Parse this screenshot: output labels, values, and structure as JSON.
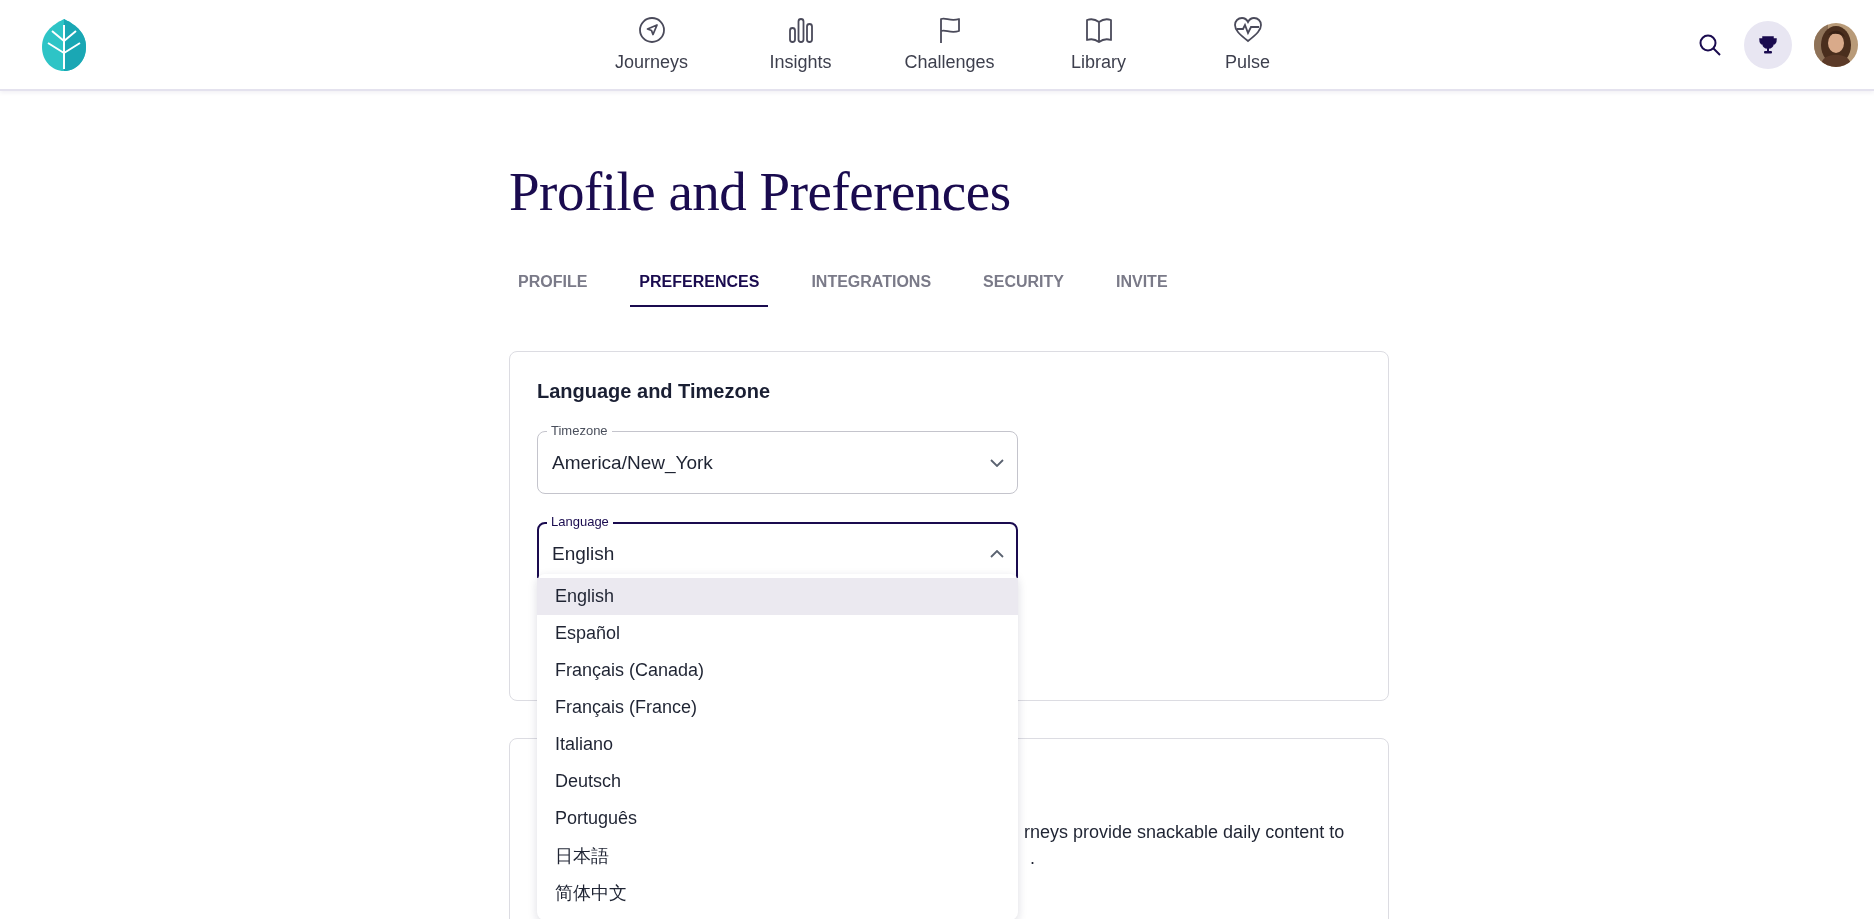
{
  "nav": [
    {
      "label": "Journeys"
    },
    {
      "label": "Insights"
    },
    {
      "label": "Challenges"
    },
    {
      "label": "Library"
    },
    {
      "label": "Pulse"
    }
  ],
  "page_title": "Profile and Preferences",
  "tabs": [
    {
      "label": "PROFILE",
      "selected": false
    },
    {
      "label": "PREFERENCES",
      "selected": true
    },
    {
      "label": "INTEGRATIONS",
      "selected": false
    },
    {
      "label": "SECURITY",
      "selected": false
    },
    {
      "label": "INVITE",
      "selected": false
    }
  ],
  "language_card": {
    "title": "Language and Timezone",
    "timezone": {
      "label": "Timezone",
      "value": "America/New_York",
      "expanded": false
    },
    "language": {
      "label": "Language",
      "value": "English",
      "expanded": true
    }
  },
  "language_menu": [
    {
      "label": "English",
      "selected": true
    },
    {
      "label": "Español",
      "selected": false
    },
    {
      "label": "Français (Canada)",
      "selected": false
    },
    {
      "label": "Français (France)",
      "selected": false
    },
    {
      "label": "Italiano",
      "selected": false
    },
    {
      "label": "Deutsch",
      "selected": false
    },
    {
      "label": "Português",
      "selected": false
    },
    {
      "label": "日本語",
      "selected": false
    },
    {
      "label": "简体中文",
      "selected": false
    }
  ],
  "second_card": {
    "text_lines": [
      "rneys provide snackable daily content to",
      "."
    ]
  }
}
